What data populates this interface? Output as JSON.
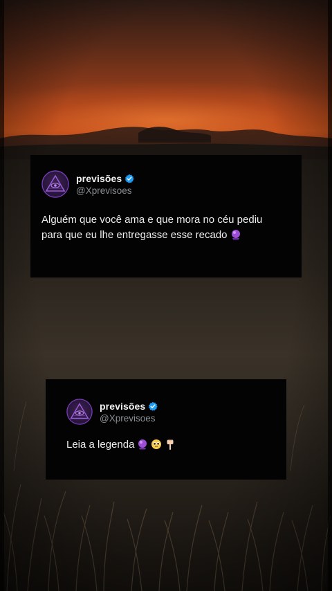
{
  "posts": [
    {
      "author": {
        "name": "previsões",
        "handle": "@Xprevisoes",
        "verified": true,
        "avatar_icon": "illuminati-eye-pyramid-icon"
      },
      "text_line_1": "Alguém que você ama e que mora no céu pediu",
      "text_line_2": "para que eu lhe entregasse esse recado",
      "emojis": [
        "crystal-ball-icon"
      ]
    },
    {
      "author": {
        "name": "previsões",
        "handle": "@Xprevisoes",
        "verified": true,
        "avatar_icon": "illuminati-eye-pyramid-icon"
      },
      "text": "Leia a legenda",
      "emojis": [
        "crystal-ball-icon",
        "pleading-face-icon",
        "pointing-down-hand-icon"
      ]
    }
  ],
  "colors": {
    "card_background": "#030303",
    "verified_badge": "#1d9bf0",
    "handle_text": "#8b8f94",
    "avatar_purple": "#7b3fb8"
  }
}
